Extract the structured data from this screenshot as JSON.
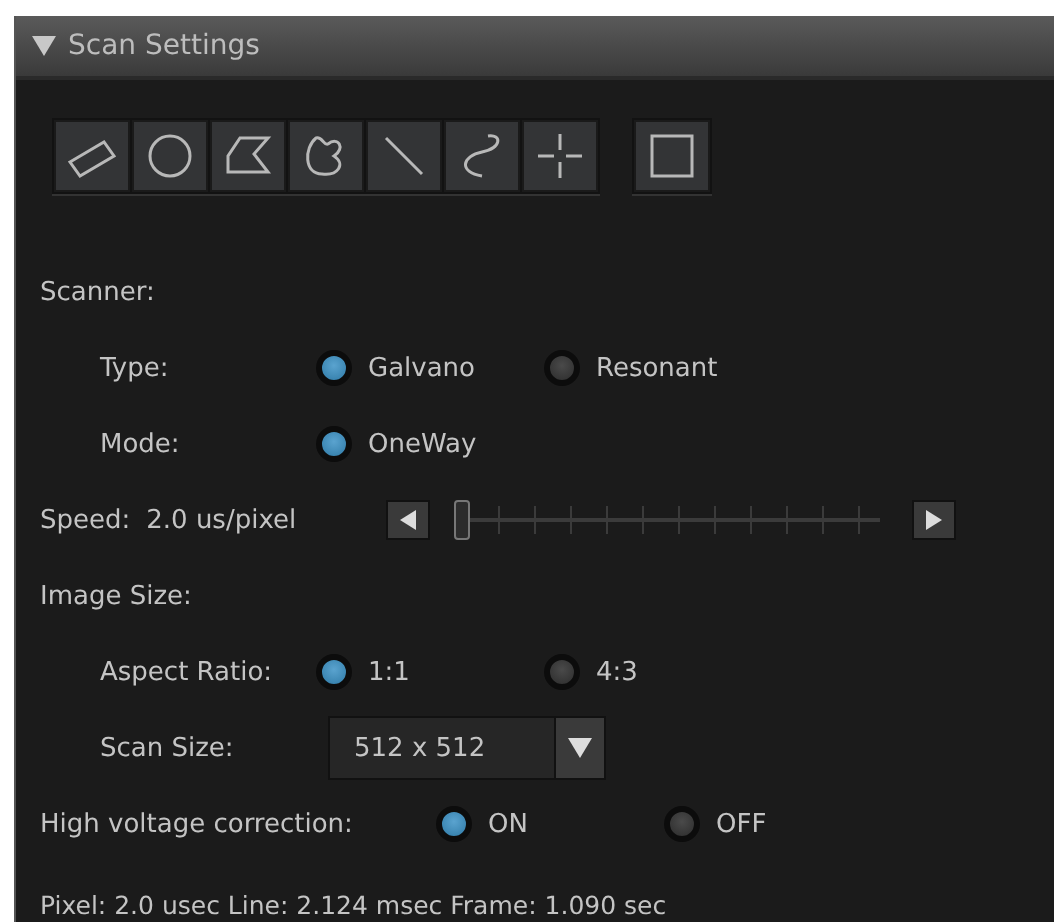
{
  "panel": {
    "title": "Scan Settings",
    "expanded": true
  },
  "scanner": {
    "label": "Scanner:",
    "type": {
      "label": "Type:",
      "options": [
        {
          "label": "Galvano",
          "selected": true
        },
        {
          "label": "Resonant",
          "selected": false
        }
      ]
    },
    "mode": {
      "label": "Mode:",
      "options": [
        {
          "label": "OneWay",
          "selected": true
        }
      ]
    }
  },
  "speed": {
    "label": "Speed:",
    "value": "2.0 us/pixel",
    "level": 0
  },
  "image_size": {
    "label": "Image Size:",
    "aspect_ratio": {
      "label": "Aspect Ratio:",
      "options": [
        {
          "label": "1:1",
          "selected": true
        },
        {
          "label": "4:3",
          "selected": false
        }
      ]
    },
    "scan_size": {
      "label": "Scan Size:",
      "value": "512 x 512"
    }
  },
  "high_voltage_correction": {
    "label": "High voltage correction:",
    "options": [
      {
        "label": "ON",
        "selected": true
      },
      {
        "label": "OFF",
        "selected": false
      }
    ]
  },
  "status": "Pixel: 2.0 usec Line: 2.124 msec Frame: 1.090 sec"
}
